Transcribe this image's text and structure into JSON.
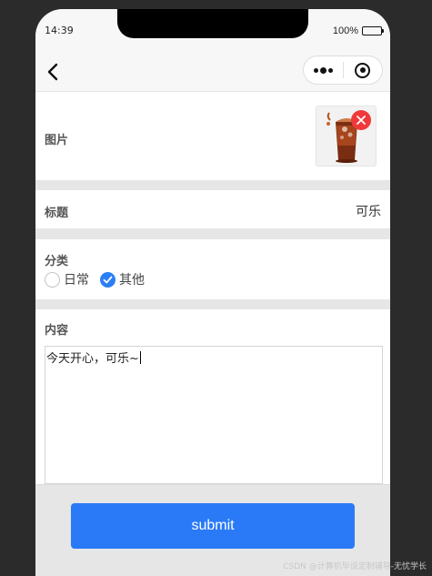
{
  "status_bar": {
    "time": "14:39",
    "battery": "100%"
  },
  "nav": {
    "back_icon": "chevron-left-icon",
    "more_icon": "more-dots-icon",
    "close_icon": "target-circle-icon"
  },
  "form": {
    "image": {
      "label": "图片",
      "thumbnail_icon": "cola-drink-image",
      "delete_icon": "close-icon"
    },
    "title": {
      "label": "标题",
      "value": "可乐"
    },
    "category": {
      "label": "分类",
      "options": [
        {
          "label": "日常",
          "checked": false
        },
        {
          "label": "其他",
          "checked": true
        }
      ]
    },
    "content": {
      "label": "内容",
      "value": "今天开心，可乐~"
    }
  },
  "submit_label": "submit",
  "watermark": "CSDN @计算机毕设定制辅导-无忧学长",
  "colors": {
    "accent": "#2a7af7",
    "delete": "#f0393a",
    "background": "#2b2b2b"
  }
}
